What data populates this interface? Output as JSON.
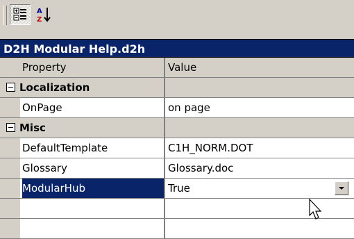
{
  "toolbar": {
    "categorized_icon": "categorized-view-icon",
    "alphabetical_icon": "alphabetical-sort-icon"
  },
  "object_title": "D2H Modular Help.d2h",
  "columns": {
    "property": "Property",
    "value": "Value"
  },
  "categories": [
    {
      "name": "Localization",
      "properties": [
        {
          "name": "OnPage",
          "value": "on page"
        }
      ]
    },
    {
      "name": "Misc",
      "properties": [
        {
          "name": "DefaultTemplate",
          "value": "C1H_NORM.DOT"
        },
        {
          "name": "Glossary",
          "value": "Glossary.doc"
        },
        {
          "name": "ModularHub",
          "value": "True",
          "selected": true
        }
      ]
    }
  ],
  "colors": {
    "selection": "#0a246a",
    "face": "#d4d0c8",
    "window": "#ffffff"
  }
}
